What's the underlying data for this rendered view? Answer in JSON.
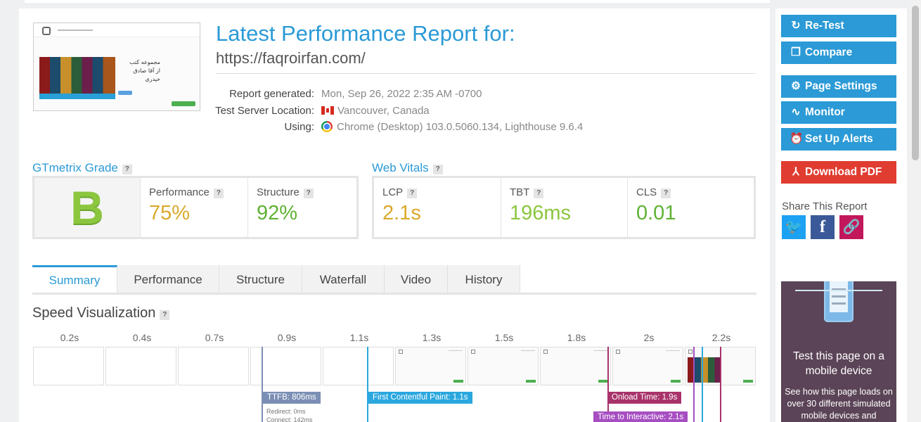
{
  "report": {
    "title": "Latest Performance Report for:",
    "url": "https://faqroirfan.com/",
    "thumbnail_text": [
      "مجموعه کتب",
      "از آقا صادق حیدری"
    ],
    "meta": [
      {
        "label": "Report generated:",
        "value": "Mon, Sep 26, 2022 2:35 AM -0700",
        "icon": ""
      },
      {
        "label": "Test Server Location:",
        "value": "Vancouver, Canada",
        "icon": "canada-flag-icon"
      },
      {
        "label": "Using:",
        "value": "Chrome (Desktop) 103.0.5060.134, Lighthouse 9.6.4",
        "icon": "chrome-icon"
      }
    ]
  },
  "grade": {
    "title": "GTmetrix Grade",
    "letter": "B",
    "metrics": [
      {
        "label": "Performance",
        "value": "75%",
        "color": "#d9a92b"
      },
      {
        "label": "Structure",
        "value": "92%",
        "color": "#5fb233"
      }
    ]
  },
  "vitals": {
    "title": "Web Vitals",
    "metrics": [
      {
        "label": "LCP",
        "value": "2.1s",
        "color": "#d9a92b"
      },
      {
        "label": "TBT",
        "value": "196ms",
        "color": "#8cc63f"
      },
      {
        "label": "CLS",
        "value": "0.01",
        "color": "#5fb233"
      }
    ]
  },
  "tabs": [
    "Summary",
    "Performance",
    "Structure",
    "Waterfall",
    "Video",
    "History"
  ],
  "active_tab": "Summary",
  "speed": {
    "title": "Speed Visualization",
    "ticks": [
      "0.2s",
      "0.4s",
      "0.7s",
      "0.9s",
      "1.1s",
      "1.3s",
      "1.5s",
      "1.8s",
      "2s",
      "2.2s"
    ],
    "markers": [
      {
        "label": "TTFB: 806ms",
        "color": "#7b8fb5"
      },
      {
        "label": "First Contentful Paint: 1.1s",
        "color": "#2aa7de"
      },
      {
        "label": "Onload Time: 1.9s",
        "color": "#a8336b"
      },
      {
        "label": "Time to Interactive: 2.1s",
        "color": "#a64ec2"
      }
    ],
    "ttfb_details": [
      "Redirect: 0ms",
      "Connect: 142ms"
    ]
  },
  "sidebar": {
    "buttons": [
      {
        "label": "Re-Test",
        "icon": "refresh-icon"
      },
      {
        "label": "Compare",
        "icon": "compare-icon"
      },
      {
        "label": "Page Settings",
        "icon": "gear-icon"
      },
      {
        "label": "Monitor",
        "icon": "pulse-icon"
      },
      {
        "label": "Set Up Alerts",
        "icon": "alarm-clock-icon"
      },
      {
        "label": "Download PDF",
        "icon": "pdf-icon"
      }
    ],
    "share_title": "Share This Report",
    "share_icons": [
      "twitter-icon",
      "facebook-icon",
      "link-icon"
    ],
    "promo": {
      "heading": "Test this page on a mobile device",
      "text": "See how this page loads on over 30 different simulated mobile devices and"
    }
  }
}
